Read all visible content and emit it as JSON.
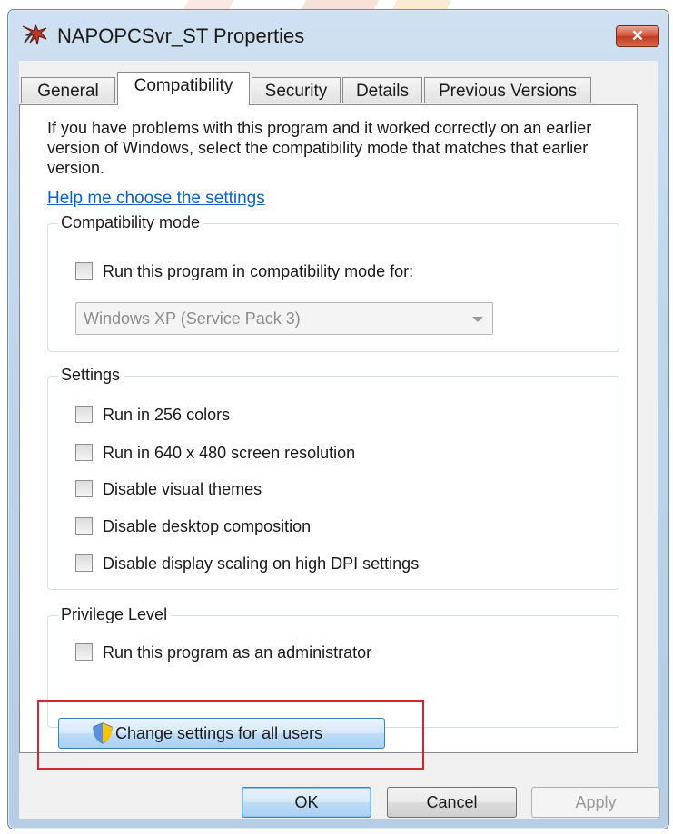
{
  "window": {
    "title": "NAPOPCSvr_ST Properties",
    "close_symbol": "✕"
  },
  "tabs": [
    {
      "label": "General"
    },
    {
      "label": "Compatibility"
    },
    {
      "label": "Security"
    },
    {
      "label": "Details"
    },
    {
      "label": "Previous Versions"
    }
  ],
  "active_tab": "Compatibility",
  "intro_text": "If you have problems with this program and it worked correctly on an earlier version of Windows, select the compatibility mode that matches that earlier version.",
  "help_link": "Help me choose the settings",
  "compat_mode": {
    "group_label": "Compatibility mode",
    "checkbox_label": "Run this program in compatibility mode for:",
    "checked": false,
    "selected_os": "Windows XP (Service Pack 3)"
  },
  "settings": {
    "group_label": "Settings",
    "items": [
      {
        "label": "Run in 256 colors",
        "checked": false
      },
      {
        "label": "Run in 640 x 480 screen resolution",
        "checked": false
      },
      {
        "label": "Disable visual themes",
        "checked": false
      },
      {
        "label": "Disable desktop composition",
        "checked": false
      },
      {
        "label": "Disable display scaling on high DPI settings",
        "checked": false
      }
    ]
  },
  "privilege": {
    "group_label": "Privilege Level",
    "checkbox_label": "Run this program as an administrator",
    "checked": false
  },
  "change_button": "Change settings for all users",
  "buttons": {
    "ok": "OK",
    "cancel": "Cancel",
    "apply": "Apply"
  },
  "colors": {
    "link": "#0a63c9",
    "highlight": "#d9232d",
    "close": "#c03a22"
  }
}
